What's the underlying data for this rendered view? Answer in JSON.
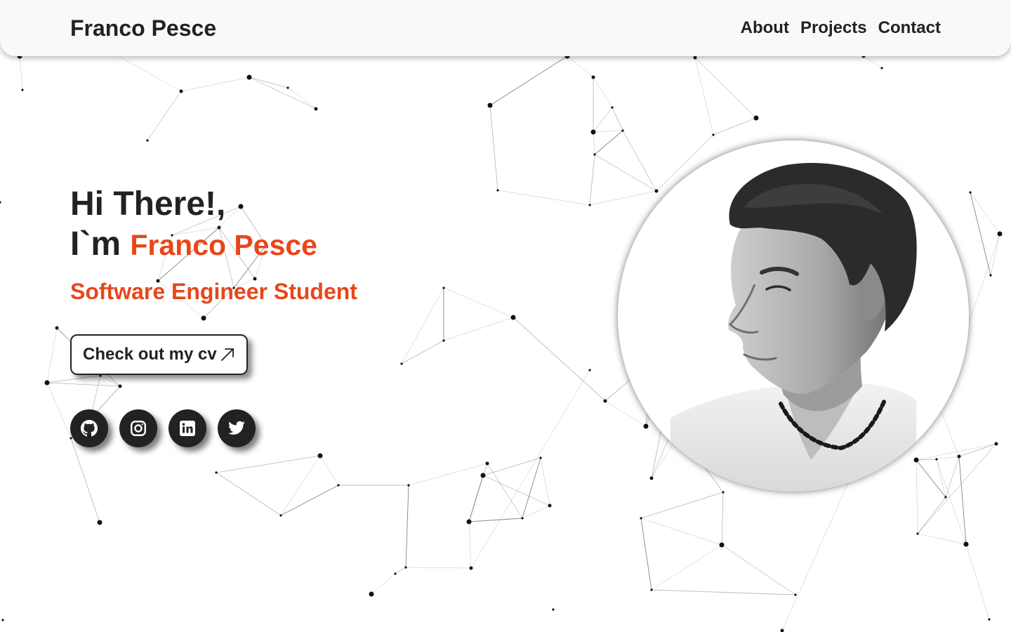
{
  "header": {
    "brand": "Franco Pesce",
    "nav": [
      "About",
      "Projects",
      "Contact"
    ]
  },
  "hero": {
    "greeting_line1": "Hi There!,",
    "greeting_prefix": "I`m",
    "name": "Franco Pesce",
    "role": "Software Engineer Student",
    "cv_label": "Check out my cv",
    "cv_icon": "arrow-up-right-icon"
  },
  "social": [
    {
      "name": "github",
      "icon": "github-icon"
    },
    {
      "name": "instagram",
      "icon": "instagram-icon"
    },
    {
      "name": "linkedin",
      "icon": "linkedin-icon"
    },
    {
      "name": "twitter",
      "icon": "twitter-icon"
    }
  ],
  "colors": {
    "accent": "#e8461a",
    "text": "#222222",
    "header_bg": "#f9f9f9",
    "background": "#ffffff"
  },
  "portrait": {
    "style": "grayscale circular profile photo",
    "icon": "profile-photo"
  }
}
